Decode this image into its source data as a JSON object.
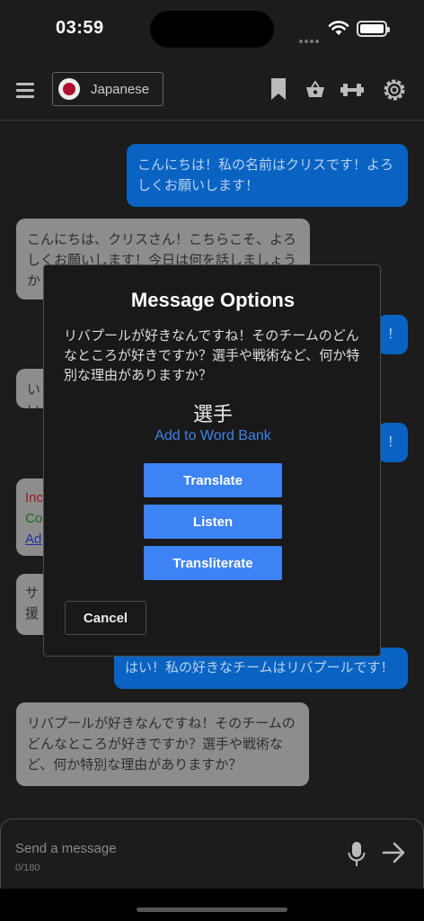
{
  "status": {
    "time": "03:59"
  },
  "nav": {
    "language": "Japanese"
  },
  "messages": [
    {
      "role": "user",
      "text": "こんにちは！私の名前はクリスです！よろしくお願いします！"
    },
    {
      "role": "bot",
      "text": "こんにちは、クリスさん！こちらこそ、よろしくお願いします！今日は何を話しましょうか"
    },
    {
      "role": "user",
      "text": "！"
    },
    {
      "role": "bot",
      "text": "いい"
    },
    {
      "role": "user",
      "text": "！"
    },
    {
      "role": "bot",
      "lines": [
        "Inc",
        "Co",
        "Ad"
      ]
    },
    {
      "role": "bot",
      "text": "サ 援"
    },
    {
      "role": "user",
      "text": "はい！私の好きなチームはリバプールです！"
    },
    {
      "role": "bot",
      "text": "リバプールが好きなんですね！そのチームのどんなところが好きですか？選手や戦術など、何か特別な理由がありますか？"
    }
  ],
  "modal": {
    "title": "Message Options",
    "text": "リバプールが好きなんですね！そのチームのどんなところが好きですか？選手や戦術など、何か特別な理由がありますか？",
    "word": "選手",
    "add_word": "Add to Word Bank",
    "translate": "Translate",
    "listen": "Listen",
    "transliterate": "Transliterate",
    "cancel": "Cancel"
  },
  "input": {
    "placeholder": "Send a message",
    "counter": "0/180"
  },
  "colors": {
    "user_bubble": "#0a63c2",
    "bot_bubble": "#8d8d8d",
    "accent": "#3d83f4"
  }
}
